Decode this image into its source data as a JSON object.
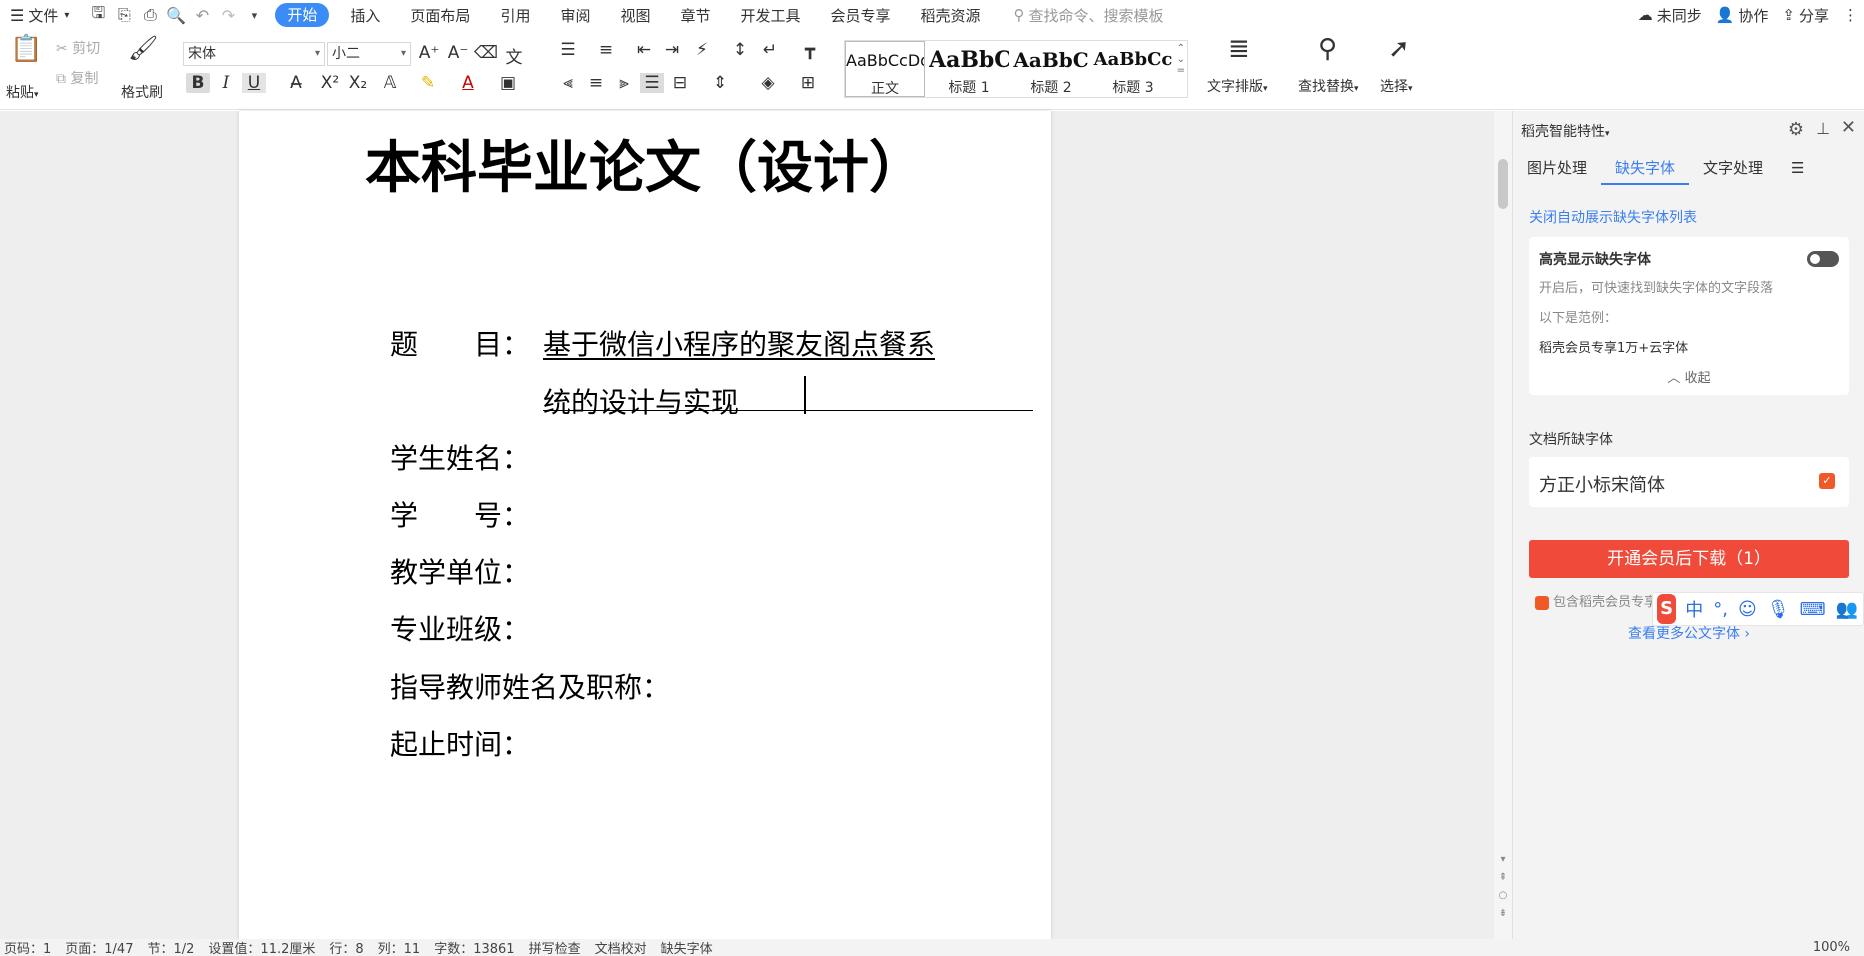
{
  "menubar": {
    "file_label": "文件",
    "tabs": [
      "开始",
      "插入",
      "页面布局",
      "引用",
      "审阅",
      "视图",
      "章节",
      "开发工具",
      "会员专享",
      "稻壳资源"
    ],
    "search_placeholder": "查找命令、搜索模板",
    "sync": "未同步",
    "collab": "协作",
    "share": "分享"
  },
  "ribbon": {
    "paste": "粘贴",
    "cut": "剪切",
    "copy": "复制",
    "format_painter": "格式刷",
    "font_name": "宋体",
    "font_size": "小二",
    "styles": [
      {
        "preview": "AaBbCcDd",
        "name": "正文"
      },
      {
        "preview": "AaBbC",
        "name": "标题 1"
      },
      {
        "preview": "AaBbC",
        "name": "标题 2"
      },
      {
        "preview": "AaBbCc",
        "name": "标题 3"
      }
    ],
    "text_layout": "文字排版",
    "find_replace": "查找替换",
    "select": "选择"
  },
  "document": {
    "title": "本科毕业论文（设计）",
    "topic_label": "题　　目：",
    "topic_line1": "基于微信小程序的聚友阁点餐系",
    "topic_line2": "统的设计与实现",
    "student_name": "学生姓名：",
    "student_id": "学　　号：",
    "unit": "教学单位：",
    "class": "专业班级：",
    "advisor": "指导教师姓名及职称：",
    "period": "起止时间："
  },
  "panel": {
    "header": "稻壳智能特性",
    "tabs": [
      "图片处理",
      "缺失字体",
      "文字处理"
    ],
    "close_auto_link": "关闭自动展示缺失字体列表",
    "highlight_title": "高亮显示缺失字体",
    "highlight_desc": "开启后，可快速找到缺失字体的文字段落",
    "example_label": "以下是范例：",
    "example_text": "稻壳会员专享1万+云字体",
    "collapse": "收起",
    "missing_fonts_title": "文档所缺字体",
    "missing_font": "方正小标宋简体",
    "download_btn": "开通会员后下载（1）",
    "note": "包含稻壳会员专享字体，需开通稻壳会员",
    "more_link": "查看更多公文字体"
  },
  "statusbar": {
    "items": [
      "页码：1",
      "页面：1/47",
      "节：1/2",
      "设置值：11.2厘米",
      "行：8",
      "列：11",
      "字数：13861",
      "拼写检查",
      "文档校对",
      "缺失字体"
    ],
    "zoom": "100%"
  },
  "ime": {
    "mode": "中"
  }
}
